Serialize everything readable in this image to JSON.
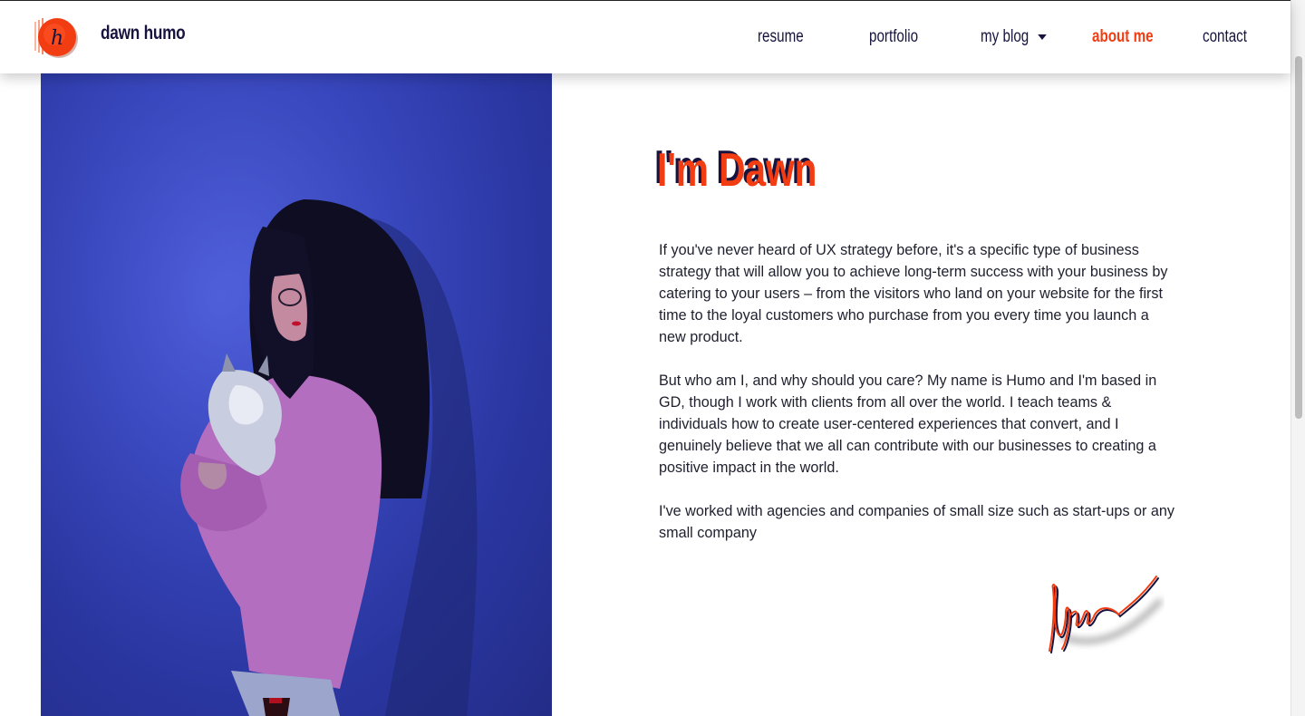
{
  "brand": {
    "name": "dawn humo",
    "logo_letter": "h"
  },
  "nav": {
    "items": [
      {
        "label": "resume"
      },
      {
        "label": "portfolio"
      },
      {
        "label": "my blog"
      },
      {
        "label": "about me"
      },
      {
        "label": "contact"
      }
    ],
    "active": "about me"
  },
  "about": {
    "heading": "I'm Dawn",
    "paragraphs": [
      "If you've never heard of UX strategy before, it's a specific type of business strategy that will allow you to achieve long-term success with your business by catering to your users – from the visitors who land on your website for the first time to the loyal customers who purchase from you every time you launch a new product.",
      "But who am I, and why should you care? My name is Humo and I'm based in GD, though I work with clients from all over the world. I teach teams & individuals how to create user-centered experiences that convert, and I genuinely believe that we all can contribute with our businesses to creating a positive impact in the world.",
      "I've worked with agencies and companies of small size such as start-ups or any small company"
    ]
  },
  "colors": {
    "accent": "#f23c12",
    "navy": "#16133e",
    "photo_bg": "#3848c4",
    "sweater": "#b46ec0"
  }
}
